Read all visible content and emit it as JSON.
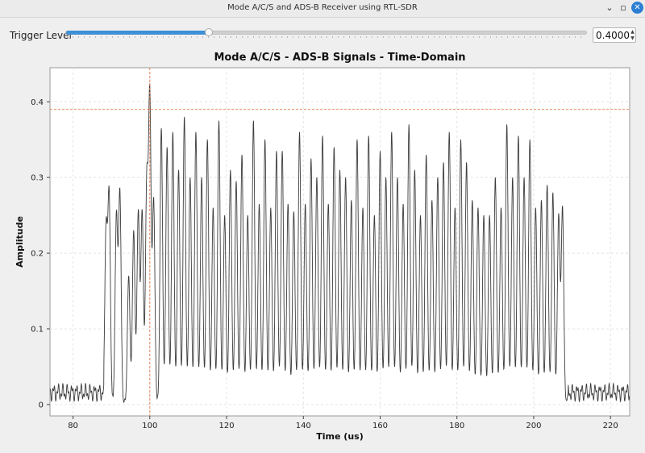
{
  "window": {
    "title": "Mode A/C/S and ADS-B Receiver using RTL-SDR",
    "minimize_icon": "minimize-icon",
    "maximize_icon": "maximize-icon",
    "close_icon": "close-icon",
    "accent_color": "#2a7fd4"
  },
  "trigger": {
    "label": "Trigger Level",
    "value": "0.4000",
    "slider_fraction": 0.4
  },
  "chart_data": {
    "type": "line",
    "title": "Mode A/C/S - ADS-B Signals - Time-Domain",
    "xlabel": "Time (us)",
    "ylabel": "Amplitude",
    "xlim": [
      74,
      225
    ],
    "ylim": [
      -0.015,
      0.445
    ],
    "x_ticks": [
      80,
      100,
      120,
      140,
      160,
      180,
      200,
      220
    ],
    "y_ticks": [
      0,
      0.1,
      0.2,
      0.3,
      0.4
    ],
    "x_tick_labels": [
      "80",
      "100",
      "120",
      "140",
      "160",
      "180",
      "200",
      "220"
    ],
    "y_tick_labels": [
      "0",
      "0.1",
      "0.2",
      "0.3",
      "0.4"
    ],
    "grid": true,
    "line_color": "#3c3c3c",
    "marker_color": "#e8865a",
    "trigger_marker": {
      "x": 100,
      "y": 0.39
    },
    "noise_level": 0.012,
    "pulse_window_us": [
      88,
      209
    ],
    "pulses": [
      [
        88.6,
        0.23
      ],
      [
        89.4,
        0.275
      ],
      [
        91.3,
        0.25
      ],
      [
        92.2,
        0.28
      ],
      [
        94.5,
        0.17
      ],
      [
        95.8,
        0.23
      ],
      [
        97.0,
        0.255
      ],
      [
        98.0,
        0.255
      ],
      [
        99.2,
        0.29
      ],
      [
        100.0,
        0.405
      ],
      [
        101.0,
        0.27
      ],
      [
        103.0,
        0.365
      ],
      [
        104.5,
        0.34
      ],
      [
        106.0,
        0.36
      ],
      [
        107.5,
        0.31
      ],
      [
        109.0,
        0.38
      ],
      [
        110.5,
        0.3
      ],
      [
        112.0,
        0.36
      ],
      [
        113.5,
        0.3
      ],
      [
        115.0,
        0.35
      ],
      [
        116.5,
        0.26
      ],
      [
        118.0,
        0.375
      ],
      [
        119.5,
        0.25
      ],
      [
        121.0,
        0.31
      ],
      [
        122.5,
        0.295
      ],
      [
        124.0,
        0.33
      ],
      [
        125.5,
        0.25
      ],
      [
        127.0,
        0.375
      ],
      [
        128.5,
        0.265
      ],
      [
        130.0,
        0.35
      ],
      [
        131.5,
        0.26
      ],
      [
        133.0,
        0.335
      ],
      [
        134.5,
        0.335
      ],
      [
        136.0,
        0.265
      ],
      [
        137.5,
        0.255
      ],
      [
        139.0,
        0.36
      ],
      [
        140.5,
        0.265
      ],
      [
        142.0,
        0.325
      ],
      [
        143.5,
        0.3
      ],
      [
        145.0,
        0.355
      ],
      [
        146.5,
        0.265
      ],
      [
        148.0,
        0.34
      ],
      [
        149.5,
        0.31
      ],
      [
        151.0,
        0.3
      ],
      [
        152.5,
        0.27
      ],
      [
        154.0,
        0.35
      ],
      [
        155.5,
        0.26
      ],
      [
        157.0,
        0.355
      ],
      [
        158.5,
        0.25
      ],
      [
        160.0,
        0.335
      ],
      [
        161.5,
        0.3
      ],
      [
        163.0,
        0.36
      ],
      [
        164.5,
        0.3
      ],
      [
        166.0,
        0.265
      ],
      [
        167.5,
        0.37
      ],
      [
        169.0,
        0.31
      ],
      [
        170.5,
        0.25
      ],
      [
        172.0,
        0.33
      ],
      [
        173.5,
        0.27
      ],
      [
        175.0,
        0.3
      ],
      [
        176.5,
        0.32
      ],
      [
        178.0,
        0.36
      ],
      [
        179.5,
        0.26
      ],
      [
        181.0,
        0.35
      ],
      [
        182.5,
        0.32
      ],
      [
        184.0,
        0.27
      ],
      [
        185.5,
        0.26
      ],
      [
        187.0,
        0.25
      ],
      [
        188.5,
        0.25
      ],
      [
        190.0,
        0.3
      ],
      [
        191.5,
        0.26
      ],
      [
        193.0,
        0.37
      ],
      [
        194.5,
        0.3
      ],
      [
        196.0,
        0.355
      ],
      [
        197.5,
        0.3
      ],
      [
        199.0,
        0.35
      ],
      [
        200.5,
        0.26
      ],
      [
        202.0,
        0.27
      ],
      [
        203.5,
        0.29
      ],
      [
        205.0,
        0.28
      ],
      [
        206.5,
        0.25
      ],
      [
        207.5,
        0.26
      ]
    ]
  }
}
